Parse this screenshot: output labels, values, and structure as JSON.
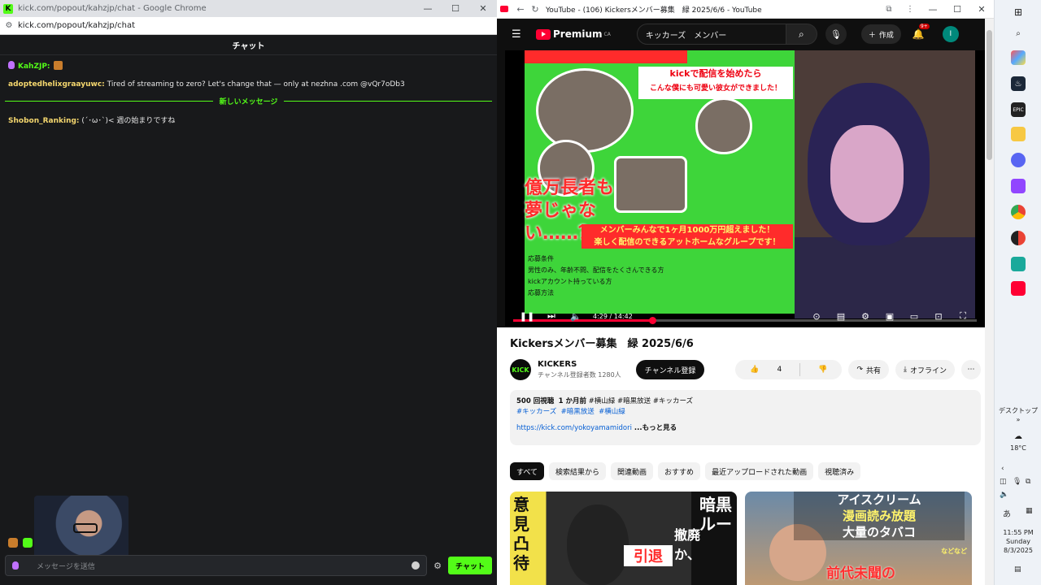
{
  "chat_window": {
    "title": "kick.com/popout/kahzjp/chat - Google Chrome",
    "url": "kick.com/popout/kahzjp/chat",
    "header": "チャット",
    "messages": [
      {
        "user": "KahZJP:",
        "text": ""
      },
      {
        "user": "adoptedhelixgraayuwc:",
        "text": " Tired of streaming to zero? Let's change that — only at nezhna .com @vQr7oDb3"
      }
    ],
    "new_messages_label": "新しいメッセージ",
    "messages_after": [
      {
        "user": "Shobon_Ranking:",
        "text": " (´･ω･`)< 週の始まりですね"
      }
    ],
    "input_placeholder": "メッセージを送信",
    "send_label": "チャット"
  },
  "youtube_window": {
    "title": "YouTube - (106) Kickersメンバー募集　緑 2025/6/6 - YouTube",
    "logo_text": "Premium",
    "logo_region": "CA",
    "search_value": "キッカーズ　メンバー",
    "create_label": "作成",
    "notification_count": "9+",
    "avatar_letter": "I",
    "player": {
      "time_current": "4:29",
      "time_separator": " / ",
      "time_total": "14:42",
      "progress": 0.3
    },
    "thumbnail_text": {
      "caption1_line1": "kickで配信を始めたら",
      "caption1_line2": "こんな僕にも可愛い彼女ができました！",
      "caption2": "億万長者も夢じゃない……？",
      "caption3_line1": "メンバーみんなで1ヶ月1000万円超えました！",
      "caption3_line2": "楽しく配信のできるアットホームなグループです！",
      "caption4_line1": "応募条件",
      "caption4_line2": "男性のみ、年齢不問、配信をたくさんできる方",
      "caption4_line3": "kickアカウント持っている方",
      "caption4_line4": "応募方法"
    },
    "video_title": "Kickersメンバー募集　緑 2025/6/6",
    "channel": {
      "name": "KICKERS",
      "subscribers": "チャンネル登録者数 1280人",
      "avatar_text": "KICK",
      "subscribe_label": "チャンネル登録"
    },
    "actions": {
      "likes": "4",
      "share_label": "共有",
      "offline_label": "オフライン"
    },
    "description": {
      "views": "500 回視聴",
      "age": "1 か月前",
      "inline_tags": "#横山緑 #暗黒放送 #キッカーズ",
      "hashtags": [
        "#キッカーズ",
        "#暗黒放送",
        "#横山緑"
      ],
      "link": "https://kick.com/yokoyamamidori",
      "more_label": " ...もっと見る"
    },
    "chips": [
      "すべて",
      "検索結果から",
      "関連動画",
      "おすすめ",
      "最近アップロードされた動画",
      "視聴済み"
    ],
    "recommended": [
      {
        "text1": "意見凸待",
        "text2": "暗黒ルー",
        "text3": "引退",
        "text4": "撤廃か、"
      },
      {
        "text1": "アイスクリーム",
        "text2": "漫画読み放題",
        "text3": "大量のタバコ",
        "text4": "前代未聞の",
        "text5": "などなど"
      }
    ]
  },
  "taskbar": {
    "desktop_label": "デスクトップ",
    "temperature": "18°C",
    "ime": "あ",
    "time": "11:55 PM",
    "day": "Sunday",
    "date": "8/3/2025"
  }
}
